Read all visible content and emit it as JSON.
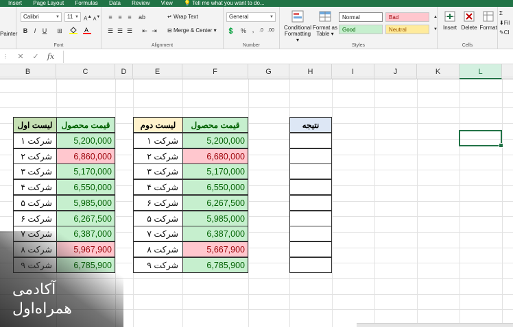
{
  "ribbon_tabs": [
    "Insert",
    "Page Layout",
    "Formulas",
    "Data",
    "Review",
    "View",
    "Tell me what you want to do..."
  ],
  "ribbon": {
    "clipboard_painter": "Painter",
    "font_name": "Calibri",
    "font_size": "11",
    "font_group": "Font",
    "bold": "B",
    "italic": "I",
    "underline": "U",
    "wrap_text": "Wrap Text",
    "merge_center": "Merge & Center",
    "alignment_group": "Alignment",
    "number_format": "General",
    "number_group": "Number",
    "conditional_formatting": [
      "Conditional",
      "Formatting"
    ],
    "format_as_table": [
      "Format as",
      "Table"
    ],
    "styles_group": "Styles",
    "style_normal": "Normal",
    "style_bad": "Bad",
    "style_good": "Good",
    "style_neutral": "Neutral",
    "insert": "Insert",
    "delete": "Delete",
    "format": "Format",
    "cells_group": "Cells",
    "fill_partial": "Fil",
    "clear_partial": "Cl"
  },
  "colors": {
    "excel_green": "#217346",
    "good_fill": "#c6efce",
    "bad_fill": "#ffc7ce",
    "neutral_fill": "#ffeb9c",
    "header_green": "#c6e0b4",
    "header_yellow": "#fff2cc",
    "header_blue": "#dde7f5"
  },
  "columns": [
    "B",
    "C",
    "D",
    "E",
    "F",
    "G",
    "H",
    "I",
    "J",
    "K",
    "L"
  ],
  "selected_column": "L",
  "table1": {
    "header_list": "لیست اول",
    "header_price": "قیمت محصول",
    "rows": [
      {
        "name": "شرکت ۱",
        "price": "5,200,000",
        "status": "good"
      },
      {
        "name": "شرکت ۲",
        "price": "6,860,000",
        "status": "bad"
      },
      {
        "name": "شرکت ۳",
        "price": "5,170,000",
        "status": "good"
      },
      {
        "name": "شرکت ۴",
        "price": "6,550,000",
        "status": "good"
      },
      {
        "name": "شرکت ۵",
        "price": "5,985,000",
        "status": "good"
      },
      {
        "name": "شرکت ۶",
        "price": "6,267,500",
        "status": "good"
      },
      {
        "name": "شرکت ۷",
        "price": "6,387,000",
        "status": "good"
      },
      {
        "name": "شرکت ۸",
        "price": "5,967,900",
        "status": "bad"
      },
      {
        "name": "شرکت ۹",
        "price": "6,785,900",
        "status": "good"
      }
    ]
  },
  "table2": {
    "header_list": "لیست دوم",
    "header_price": "قیمت محصول",
    "rows": [
      {
        "name": "شرکت ۱",
        "price": "5,200,000",
        "status": "good"
      },
      {
        "name": "شرکت ۲",
        "price": "6,680,000",
        "status": "bad"
      },
      {
        "name": "شرکت ۳",
        "price": "5,170,000",
        "status": "good"
      },
      {
        "name": "شرکت ۴",
        "price": "6,550,000",
        "status": "good"
      },
      {
        "name": "شرکت ۶",
        "price": "6,267,500",
        "status": "good"
      },
      {
        "name": "شرکت ۵",
        "price": "5,985,000",
        "status": "good"
      },
      {
        "name": "شرکت ۷",
        "price": "6,387,000",
        "status": "good"
      },
      {
        "name": "شرکت ۸",
        "price": "5,667,900",
        "status": "bad"
      },
      {
        "name": "شرکت ۹",
        "price": "6,785,900",
        "status": "good"
      }
    ]
  },
  "result": {
    "header": "نتیجه",
    "rows": [
      "",
      "",
      "",
      "",
      "",
      "",
      "",
      "",
      ""
    ]
  },
  "watermark": {
    "line1": "آکادمی",
    "line2": "همراه‌اول"
  }
}
